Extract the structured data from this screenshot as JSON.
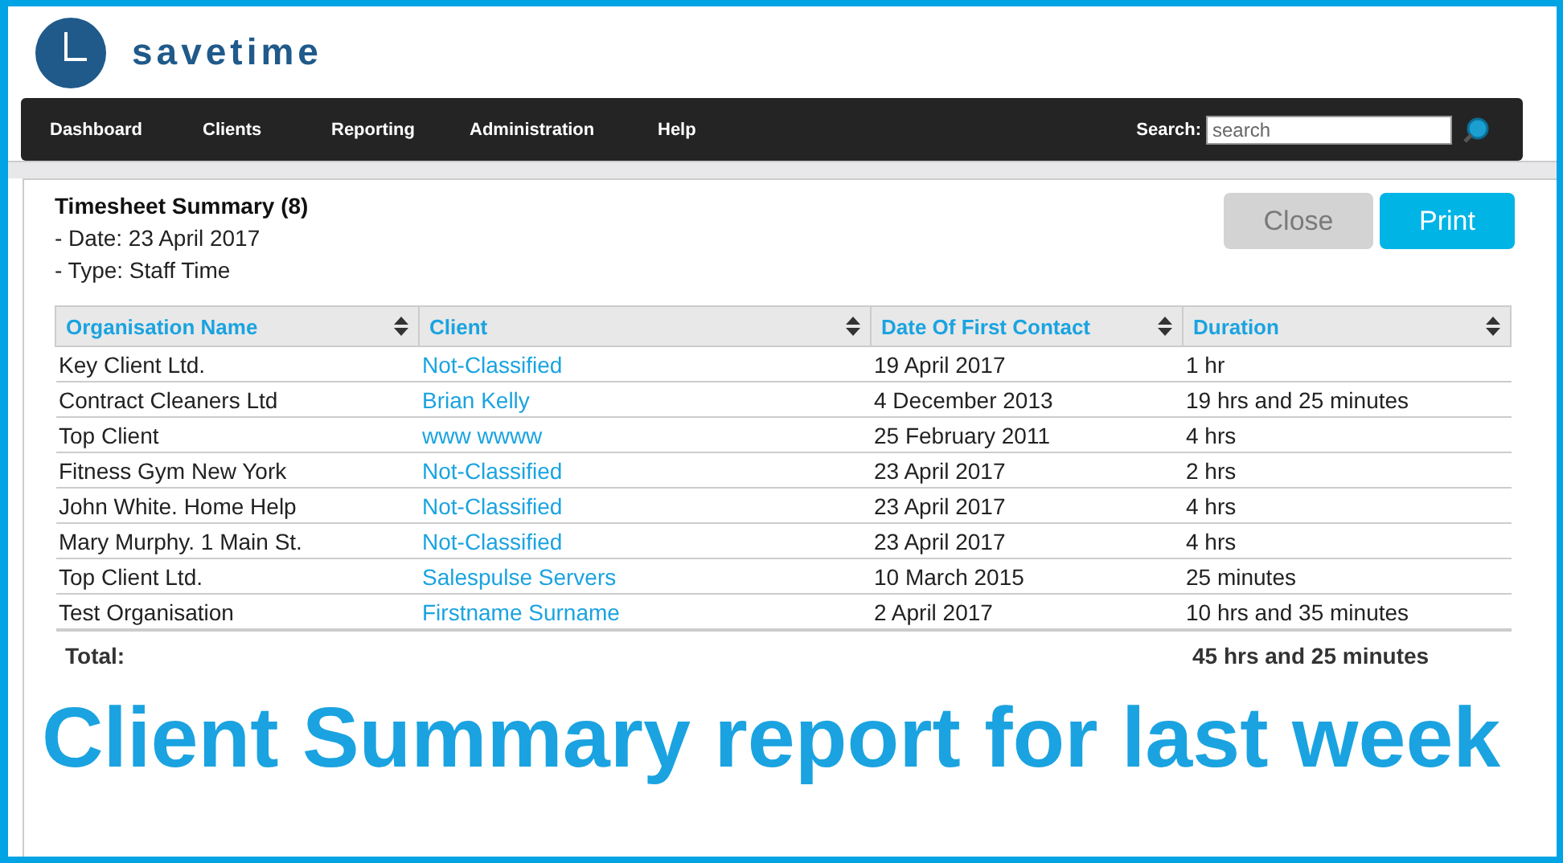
{
  "logo": {
    "text": "savetime"
  },
  "nav": {
    "items": [
      {
        "label": "Dashboard"
      },
      {
        "label": "Clients"
      },
      {
        "label": "Reporting"
      },
      {
        "label": "Administration"
      },
      {
        "label": "Help"
      }
    ],
    "search": {
      "label": "Search:",
      "placeholder": "search"
    }
  },
  "report": {
    "title": "Timesheet Summary (8)",
    "details": [
      "- Date: 23 April 2017",
      "- Type: Staff Time"
    ],
    "buttons": [
      {
        "label": "Close",
        "disabled": true
      },
      {
        "label": "Print",
        "disabled": false
      }
    ]
  },
  "table": {
    "columns": [
      "Organisation Name",
      "Client",
      "Date Of First Contact",
      "Duration"
    ],
    "rows": [
      [
        "Key Client Ltd.",
        "Not-Classified",
        "19 April 2017",
        "1 hr"
      ],
      [
        "Contract Cleaners Ltd",
        "Brian Kelly",
        "4 December 2013",
        "19 hrs and 25 minutes"
      ],
      [
        "Top Client",
        "www wwww",
        "25 February 2011",
        "4 hrs"
      ],
      [
        "Fitness Gym New York",
        "Not-Classified",
        "23 April 2017",
        "2 hrs"
      ],
      [
        "John White. Home Help",
        "Not-Classified",
        "23 April 2017",
        "4 hrs"
      ],
      [
        "Mary Murphy. 1 Main St.",
        "Not-Classified",
        "23 April 2017",
        "4 hrs"
      ],
      [
        "Top  Client Ltd.",
        "Salespulse Servers",
        "10 March 2015",
        "25 minutes"
      ],
      [
        "Test Organisation",
        "Firstname Surname",
        "2 April 2017",
        "10 hrs and 35 minutes"
      ]
    ],
    "total_label": "Total:",
    "total": "45 hrs and 25 minutes"
  },
  "caption": "Client Summary report for last week"
}
